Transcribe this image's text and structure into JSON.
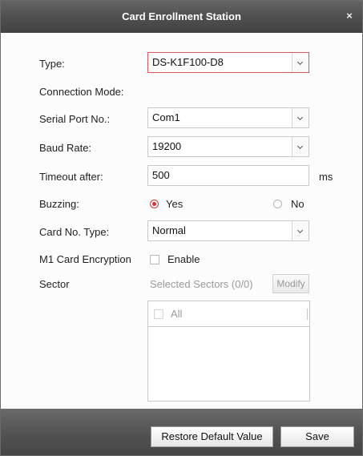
{
  "window": {
    "title": "Card Enrollment Station",
    "close_glyph": "×"
  },
  "form": {
    "type": {
      "label": "Type:",
      "value": "DS-K1F100-D8"
    },
    "connection_mode": {
      "label": "Connection Mode:"
    },
    "serial_port": {
      "label": "Serial Port No.:",
      "value": "Com1"
    },
    "baud_rate": {
      "label": "Baud Rate:",
      "value": "19200"
    },
    "timeout": {
      "label": "Timeout after:",
      "value": "500",
      "unit": "ms"
    },
    "buzzing": {
      "label": "Buzzing:",
      "yes": "Yes",
      "no": "No",
      "selected": "Yes"
    },
    "card_no_type": {
      "label": "Card No. Type:",
      "value": "Normal"
    },
    "m1_encryption": {
      "label": "M1 Card Encryption",
      "enable_label": "Enable",
      "checked": false
    },
    "sector": {
      "label": "Sector",
      "selected_text": "Selected Sectors (0/0)",
      "modify_label": "Modify",
      "all_label": "All"
    }
  },
  "footer": {
    "restore_label": "Restore Default Value",
    "save_label": "Save"
  },
  "colors": {
    "accent_red": "#d83434",
    "title_bar": "#4e4e4e"
  },
  "icons": {
    "close": "close-icon",
    "dropdown": "chevron-down-icon"
  }
}
